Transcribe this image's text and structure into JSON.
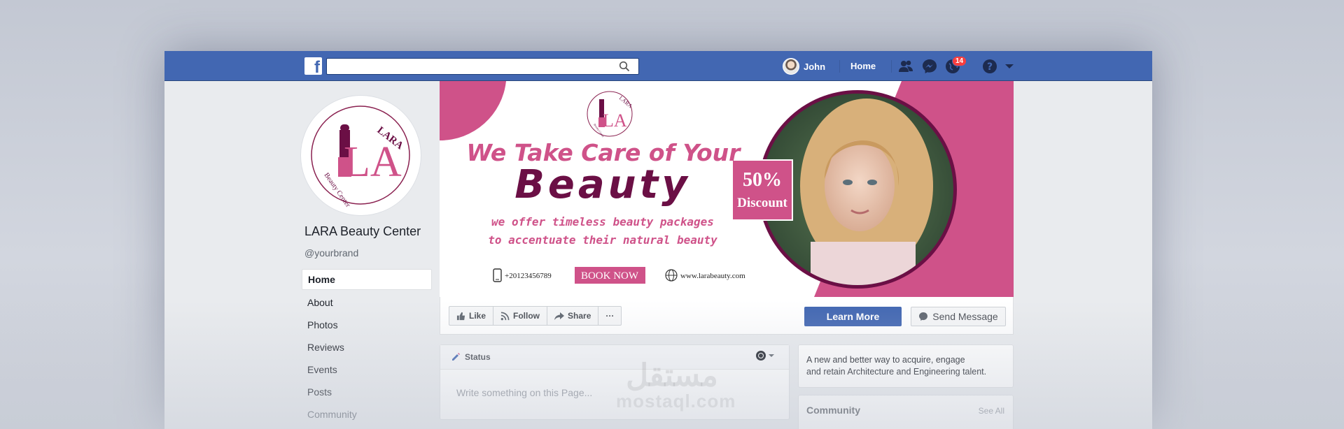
{
  "topbar": {
    "user_name": "John",
    "home_label": "Home",
    "notification_count": "14",
    "search_placeholder": ""
  },
  "profile": {
    "page_name": "LARA Beauty Center",
    "handle": "@yourbrand",
    "logo_text": "LARA",
    "logo_initials": "LA",
    "logo_subtitle": "Beauty Center"
  },
  "side_nav": {
    "items": [
      {
        "label": "Home"
      },
      {
        "label": "About"
      },
      {
        "label": "Photos"
      },
      {
        "label": "Reviews"
      },
      {
        "label": "Events"
      },
      {
        "label": "Posts"
      },
      {
        "label": "Community"
      }
    ]
  },
  "cover": {
    "headline_1": "We Take Care of Your",
    "headline_2": "Beauty",
    "tagline_1": "we offer timeless beauty packages",
    "tagline_2": "to accentuate their natural beauty",
    "discount_pct": "50%",
    "discount_label": "Discount",
    "phone": "+20123456789",
    "book_label": "BOOK NOW",
    "website": "www.larabeauty.com",
    "logo_text": "LARA",
    "logo_initials": "LA",
    "logo_subtitle": "Beauty Center"
  },
  "actions": {
    "like": "Like",
    "follow": "Follow",
    "share": "Share",
    "more": "···",
    "learn_more": "Learn More",
    "send_message": "Send Message"
  },
  "status": {
    "title": "Status",
    "placeholder": "Write something on this Page..."
  },
  "info": {
    "line1": "A new and better way to acquire, engage",
    "line2": "and retain Architecture and Engineering talent."
  },
  "community": {
    "title": "Community",
    "see_all": "See All"
  },
  "watermark": {
    "arabic": "مستقل",
    "latin": "mostaql.com"
  },
  "colors": {
    "facebook_blue": "#4267b2",
    "brand_pink": "#cf5289",
    "brand_plum": "#6b0f45"
  }
}
